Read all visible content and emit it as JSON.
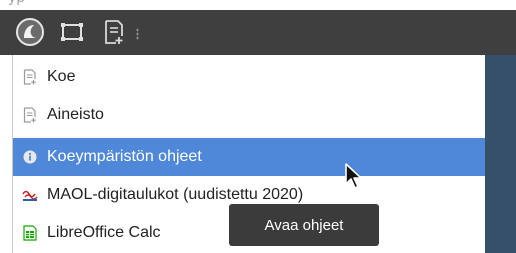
{
  "taskbar": {
    "icons": [
      "system-logo-icon",
      "window-icon",
      "new-document-icon",
      "drag-handle-icon"
    ]
  },
  "menu": {
    "items": [
      {
        "label": "Koe",
        "icon": "document-plus-icon"
      },
      {
        "label": "Aineisto",
        "icon": "document-plus-icon"
      },
      {
        "label": "Koeympäristön ohjeet",
        "icon": "info-icon",
        "selected": true
      },
      {
        "label": "MAOL-digitaulukot (uudistettu 2020)",
        "icon": "maol-icon"
      },
      {
        "label": "LibreOffice Calc",
        "icon": "spreadsheet-icon"
      }
    ]
  },
  "tooltip": {
    "text": "Avaa ohjeet"
  },
  "colors": {
    "taskbar_bg": "#3f3f3f",
    "selected_bg": "#4f87d9",
    "tooltip_bg": "#3b3b3b",
    "desktop_bg": "#364f6b"
  }
}
